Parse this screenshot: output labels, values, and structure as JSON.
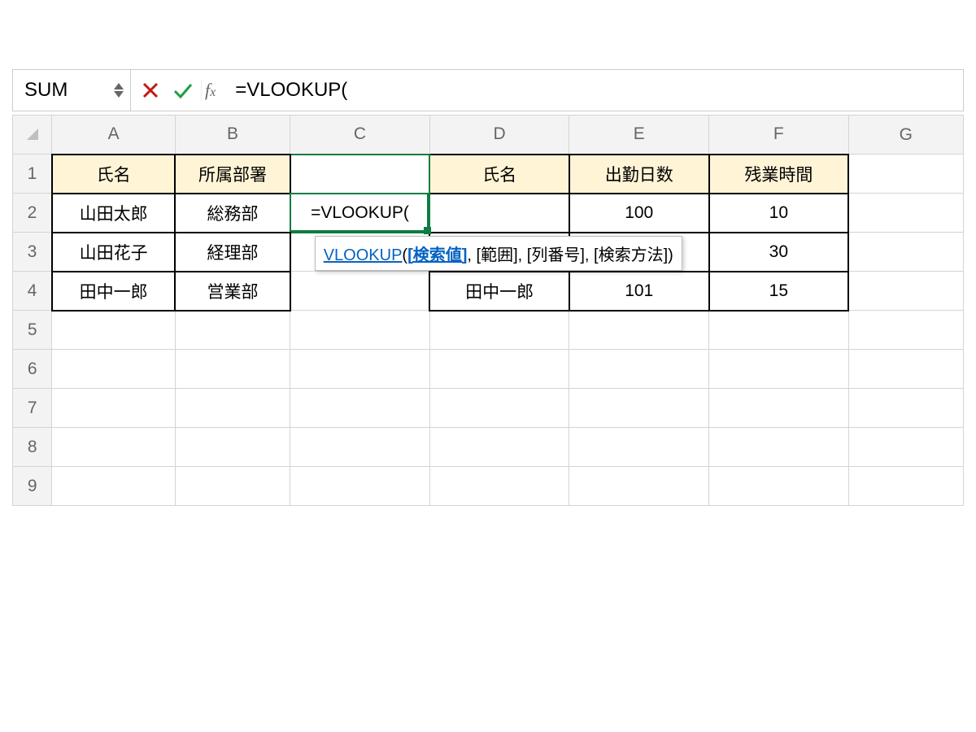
{
  "nameBox": "SUM",
  "formula": "=VLOOKUP(",
  "columns": [
    "A",
    "B",
    "C",
    "D",
    "E",
    "F",
    "G"
  ],
  "rows": [
    "1",
    "2",
    "3",
    "4",
    "5",
    "6",
    "7",
    "8",
    "9"
  ],
  "headers": {
    "A1": "氏名",
    "B1": "所属部署",
    "C1": "",
    "D1": "氏名",
    "E1": "出勤日数",
    "F1": "残業時間"
  },
  "cells": {
    "A2": "山田太郎",
    "B2": "総務部",
    "C2": "=VLOOKUP(",
    "E2": "100",
    "F2": "10",
    "A3": "山田花子",
    "B3": "経理部",
    "F3": "30",
    "A4": "田中一郎",
    "B4": "営業部",
    "D4": "田中一郎",
    "E4": "101",
    "F4": "15"
  },
  "tooltip": {
    "fn": "VLOOKUP",
    "open": "(",
    "arg_current": "[検索値]",
    "sep1": ", ",
    "arg2": "[範囲]",
    "sep2": ", ",
    "arg3": "[列番号]",
    "sep3": ", ",
    "arg4": "[検索方法]",
    "close": ")"
  }
}
